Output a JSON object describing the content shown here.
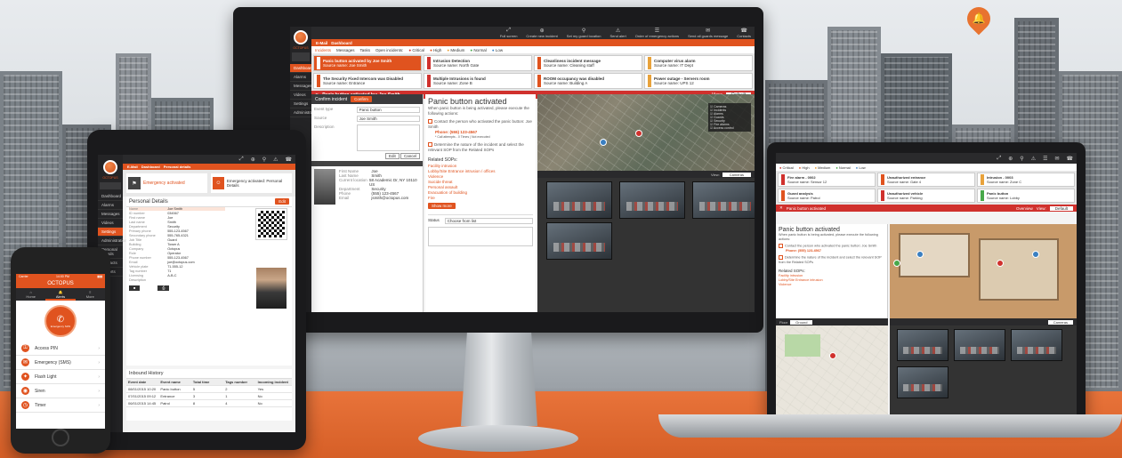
{
  "brand": {
    "name": "OCTOPUS",
    "accent_color": "#e0531f",
    "dark_color": "#242426"
  },
  "monitor": {
    "topbar_items": [
      "Full screen",
      "Create new incident",
      "Set my guard location",
      "Send alert",
      "Order of emergency actions",
      "Send all guards message",
      "Contacts",
      "Phone book"
    ],
    "header_tabs": [
      "E-Mail",
      "Dashboard"
    ],
    "subtabs": [
      "Incidents",
      "Messages",
      "Tasks"
    ],
    "open_incidents_label": "Open incidents:",
    "legend": [
      "Critical",
      "High",
      "Medium",
      "Normal",
      "Low"
    ],
    "legend_colors": [
      "#d0312d",
      "#e0531f",
      "#e8a23b",
      "#48a84a",
      "#3a7fc1"
    ],
    "sidebar_items": [
      "Dashboard",
      "Alarms",
      "Messages",
      "Videos",
      "Settings",
      "Administration"
    ],
    "incidents": [
      {
        "title": "Panic button activated by Joe Smith",
        "source": "Source name: Joe Smith"
      },
      {
        "title": "Intrusion Detection",
        "source": "Source name: North Gate"
      },
      {
        "title": "Cleanliness incident message",
        "source": "Source name: Cleaning staff"
      },
      {
        "title": "Computer virus alarm",
        "source": "Source name: IT Dept"
      },
      {
        "title": "The Security Fixed Intercom was Disabled",
        "source": "Source name: Entrance"
      },
      {
        "title": "Multiple Intrusions is found",
        "source": "Source name: Zone B"
      },
      {
        "title": "ROOM occupancy was disabled",
        "source": "Source name: Building A"
      },
      {
        "title": "Power outage - Servers room",
        "source": "Source name: UPS 12"
      }
    ],
    "alert_title": "Panic button activated by: Joe Smith",
    "view_label": "View:",
    "view_options": [
      "Default",
      "Incident report"
    ],
    "form_header": "Confirm incident",
    "confirm_button": "Confirm",
    "form_fields": [
      {
        "label": "Event type",
        "value": "Panic button"
      },
      {
        "label": "Source",
        "value": "Joe Smith"
      },
      {
        "label": "Description",
        "value": ""
      }
    ],
    "form_buttons": [
      "Edit",
      "Cancel"
    ],
    "person": {
      "first_name_label": "First Name",
      "first_name": "Joe",
      "last_name_label": "Last Name",
      "last_name": "Smith",
      "address_label": "Current location",
      "address": "58 Academic Dr, NY 10110 US",
      "department_label": "Department",
      "department": "Security",
      "phone_label": "Phone",
      "phone": "(555) 123-4567",
      "email_label": "Email",
      "email": "jsmith@octopus.com"
    },
    "sop": {
      "title": "Panic button activated",
      "intro": "When panic button is being activated, please execute the following actions:",
      "step1": "Contact the person who activated the panic button: Joe Smith",
      "phone": "Phone: (555) 123-4567",
      "step1_note": "* Call attempts - 0 Times | Not executed",
      "step2": "Determine the nature of the incident and select the relevant SOP from the Related SOPs",
      "related_title": "Related SOPs:",
      "related": [
        "Facility intrusion",
        "Lobby/Site Entrance intrusion / offices",
        "Violence",
        "Suicide threat",
        "Personal assault",
        "Evacuation of building",
        "Fire"
      ],
      "more_button": "Show more",
      "status_label": "Status",
      "choose_label": "Choose from list"
    },
    "map_layers": [
      "Cameras",
      "Incidents",
      "Alarms",
      "Guards",
      "Security",
      "Fire alarms",
      "Access control",
      "Intercom",
      "Other"
    ],
    "camera_view_label": "View:",
    "camera_view_value": "Cameras",
    "bottom_view_value": "Cameras view"
  },
  "tablet": {
    "header_tabs": [
      "E-Mail",
      "Dashboard",
      "Personal details"
    ],
    "tile1": "Emergency activated",
    "tile2": "Emergency activated: Personal Details",
    "panel_title": "Personal Details",
    "edit_button": "Edit",
    "details": [
      {
        "label": "Name",
        "value": "Joe Smith"
      },
      {
        "label": "ID number",
        "value": "034567"
      },
      {
        "label": "First name",
        "value": "Joe"
      },
      {
        "label": "Last name",
        "value": "Smith"
      },
      {
        "label": "Department",
        "value": "Security"
      },
      {
        "label": "Primary phone",
        "value": "555-123-4567"
      },
      {
        "label": "Secondary phone",
        "value": "555-765-4321"
      },
      {
        "label": "Job Title",
        "value": "Guard"
      },
      {
        "label": "Building",
        "value": "Tower A"
      },
      {
        "label": "Company",
        "value": "Octopus"
      },
      {
        "label": "Role",
        "value": "Operator"
      },
      {
        "label": "Phone number",
        "value": "555-123-4567"
      },
      {
        "label": "Email",
        "value": "joe@octopus.com"
      },
      {
        "label": "Vehicle plate",
        "value": "71-555-12"
      },
      {
        "label": "Tag number",
        "value": "71"
      },
      {
        "label": "Licensing",
        "value": "A-B-C"
      },
      {
        "label": "Description",
        "value": ""
      }
    ],
    "activity_title": "Inbound History",
    "activity_cols": [
      "Event date",
      "Event name",
      "Total time",
      "Tags number",
      "Incoming incident"
    ],
    "activity_rows": [
      [
        "08/01/2015 10:20",
        "Panic button",
        "5",
        "2",
        "Yes"
      ],
      [
        "07/01/2015 09:12",
        "Entrance",
        "3",
        "1",
        "No"
      ],
      [
        "06/01/2015 14:45",
        "Patrol",
        "8",
        "4",
        "No"
      ]
    ],
    "sidebar_items": [
      "Dashboard",
      "Alarms",
      "Messages",
      "Videos",
      "Settings",
      "Administration",
      "Personal Details",
      "Contacts",
      "Reports"
    ],
    "bottom_label": "Building 103 Personal ID"
  },
  "phone": {
    "status_time": "14:00 PM",
    "carrier": "Carrier",
    "brand": "OCTOPUS",
    "tabs": [
      "Home",
      "Alerts",
      "More"
    ],
    "emergency_label": "Emergency SOS",
    "items": [
      {
        "label": "Access PIN",
        "icon": "lock-icon"
      },
      {
        "label": "Emergency (SMS)",
        "icon": "sms-icon"
      },
      {
        "label": "Flash Light",
        "icon": "flashlight-icon"
      },
      {
        "label": "Siren",
        "icon": "siren-icon"
      },
      {
        "label": "Timer",
        "icon": "timer-icon"
      }
    ]
  },
  "laptop": {
    "topbar_items": [
      "Full screen",
      "Create new incident",
      "Set my guard location",
      "Send alert",
      "Order of emergency actions",
      "Send all guards message",
      "Contacts",
      "Phone book"
    ],
    "legend": [
      "Critical",
      "High",
      "Medium",
      "Normal",
      "Low"
    ],
    "incidents": [
      {
        "title": "Fire alarm - 0002",
        "source": "Source name: Sensor 12"
      },
      {
        "title": "Unauthorized entrance",
        "source": "Source name: Gate 4"
      },
      {
        "title": "Intrusion - 0003",
        "source": "Source name: Zone C"
      },
      {
        "title": "Guard analysis",
        "source": "Source name: Patrol"
      },
      {
        "title": "Unauthorized vehicle",
        "source": "Source name: Parking"
      },
      {
        "title": "Panic button",
        "source": "Source name: Lobby"
      }
    ],
    "alert_title": "Panic button activated",
    "overview_label": "Overview",
    "view_label": "View:",
    "view_value": "Default",
    "sop_title": "Panic button activated",
    "sop_intro": "When panic button is being activated, please execute the following actions:",
    "step1": "Contact the person who activated the panic button: Joe Smith",
    "phone": "Phone: (555) 123-4567",
    "step2": "Determine the nature of the incident and select the relevant SOP from the Related SOPs",
    "related_title": "Related SOPs:",
    "related": [
      "Facility intrusion",
      "Lobby/Site Entrance intrusion",
      "Violence"
    ],
    "floor_label": "Floor",
    "floor_value": "Ground",
    "camera_view_value": "Cameras"
  }
}
